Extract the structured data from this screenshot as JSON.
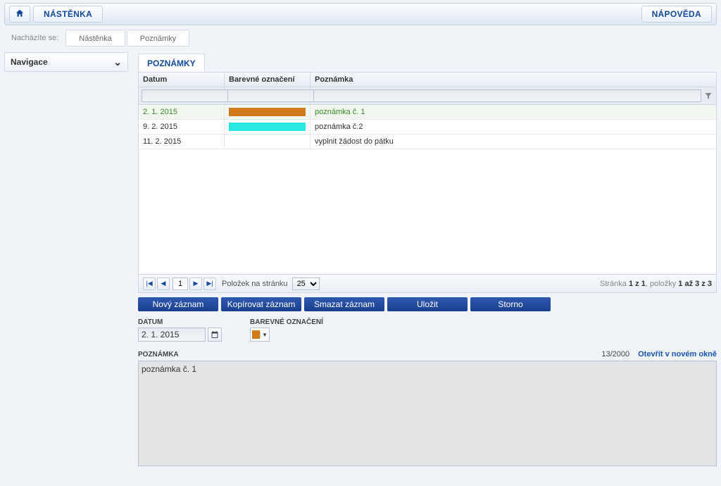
{
  "top": {
    "nastenka": "NÁSTĚNKA",
    "napoveda": "NÁPOVĚDA"
  },
  "breadcrumbs": {
    "prefix": "Nacházíte se:",
    "items": [
      "Nástěnka",
      "Poznámky"
    ]
  },
  "sidebar": {
    "nav_label": "Navigace"
  },
  "tab": {
    "label": "POZNÁMKY"
  },
  "columns": {
    "date": "Datum",
    "color": "Barevné označení",
    "note": "Poznámka"
  },
  "rows": [
    {
      "date": "2. 1. 2015",
      "color": "#d17a1b",
      "note": "poznámka č. 1",
      "selected": true
    },
    {
      "date": "9. 2. 2015",
      "color": "#2be7e2",
      "note": "poznámka č.2",
      "selected": false
    },
    {
      "date": "11. 2. 2015",
      "color": "",
      "note": "vyplnit žádost do pátku",
      "selected": false
    }
  ],
  "pager": {
    "per_page_label": "Položek na stránku",
    "per_page_value": "25",
    "current_page": "1",
    "info_prefix": "Stránka ",
    "info_pages_bold": "1 z 1",
    "info_mid": ", položky ",
    "info_items_bold": "1 až 3 z 3"
  },
  "actions": {
    "new": "Nový záznam",
    "copy": "Kopírovat záznam",
    "delete": "Smazat záznam",
    "save": "Uložit",
    "cancel": "Storno"
  },
  "form": {
    "date_label": "DATUM",
    "date_value": "2. 1. 2015",
    "color_label": "BAREVNÉ OZNAČENÍ",
    "color_value": "#d17a1b",
    "note_label": "POZNÁMKA",
    "char_count": "13/2000",
    "open_win": "Otevřít v novém okně",
    "note_value": "poznámka č. 1"
  }
}
